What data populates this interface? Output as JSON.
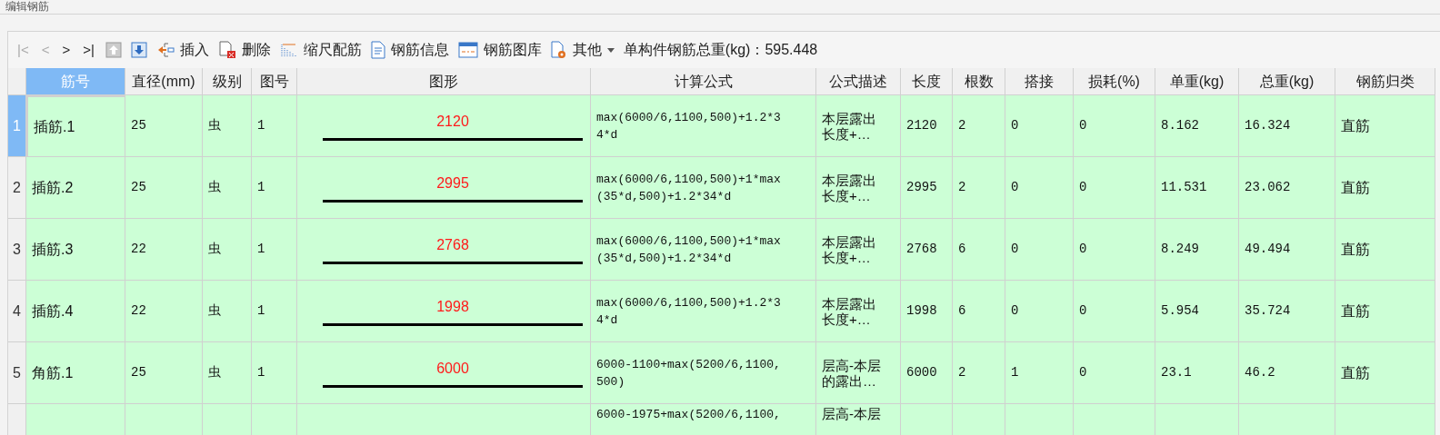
{
  "window": {
    "title": "编辑钢筋"
  },
  "toolbar": {
    "items": [
      {
        "kind": "nav",
        "label": "|<",
        "disabled": true
      },
      {
        "kind": "nav",
        "label": "<",
        "disabled": true
      },
      {
        "kind": "nav",
        "label": ">",
        "disabled": false
      },
      {
        "kind": "nav",
        "label": ">|",
        "disabled": false
      },
      {
        "kind": "up",
        "disabled": true
      },
      {
        "kind": "down",
        "disabled": false
      },
      {
        "kind": "insert",
        "label": "插入",
        "disabled": false
      },
      {
        "kind": "delete",
        "label": "删除",
        "disabled": false
      },
      {
        "kind": "scale",
        "label": "缩尺配筋",
        "disabled": false
      },
      {
        "kind": "info",
        "label": "钢筋信息",
        "disabled": false
      },
      {
        "kind": "library",
        "label": "钢筋图库",
        "disabled": false
      },
      {
        "kind": "other",
        "label": "其他",
        "disabled": false
      }
    ],
    "total": "单构件钢筋总重(kg)：595.448"
  },
  "table": {
    "columns": [
      {
        "label": "筋号",
        "selected": true
      },
      {
        "label": "直径(mm)",
        "selected": false
      },
      {
        "label": "级别",
        "selected": false
      },
      {
        "label": "图号",
        "selected": false
      },
      {
        "label": "图形",
        "selected": false
      },
      {
        "label": "计算公式",
        "selected": false
      },
      {
        "label": "公式描述",
        "selected": false
      },
      {
        "label": "长度",
        "selected": false
      },
      {
        "label": "根数",
        "selected": false
      },
      {
        "label": "搭接",
        "selected": false
      },
      {
        "label": "损耗(%)",
        "selected": false
      },
      {
        "label": "单重(kg)",
        "selected": false
      },
      {
        "label": "总重(kg)",
        "selected": false
      },
      {
        "label": "钢筋归类",
        "selected": false
      }
    ],
    "rows": [
      {
        "index": "1",
        "selected": true,
        "name": "插筋.1",
        "diameter": "25",
        "grade": "虫",
        "figure_no": "1",
        "shape_length": "2120",
        "formula": "max(6000/6,1100,500)+1.2*34*d",
        "description": "本层露出长度+…",
        "length": "2120",
        "count": "2",
        "lap": "0",
        "loss": "0",
        "unit_weight": "8.162",
        "total_weight": "16.324",
        "category": "直筋"
      },
      {
        "index": "2",
        "selected": false,
        "name": "插筋.2",
        "diameter": "25",
        "grade": "虫",
        "figure_no": "1",
        "shape_length": "2995",
        "formula": "max(6000/6,1100,500)+1*max(35*d,500)+1.2*34*d",
        "description": "本层露出长度+…",
        "length": "2995",
        "count": "2",
        "lap": "0",
        "loss": "0",
        "unit_weight": "11.531",
        "total_weight": "23.062",
        "category": "直筋"
      },
      {
        "index": "3",
        "selected": false,
        "name": "插筋.3",
        "diameter": "22",
        "grade": "虫",
        "figure_no": "1",
        "shape_length": "2768",
        "formula": "max(6000/6,1100,500)+1*max(35*d,500)+1.2*34*d",
        "description": "本层露出长度+…",
        "length": "2768",
        "count": "6",
        "lap": "0",
        "loss": "0",
        "unit_weight": "8.249",
        "total_weight": "49.494",
        "category": "直筋"
      },
      {
        "index": "4",
        "selected": false,
        "name": "插筋.4",
        "diameter": "22",
        "grade": "虫",
        "figure_no": "1",
        "shape_length": "1998",
        "formula": "max(6000/6,1100,500)+1.2*34*d",
        "description": "本层露出长度+…",
        "length": "1998",
        "count": "6",
        "lap": "0",
        "loss": "0",
        "unit_weight": "5.954",
        "total_weight": "35.724",
        "category": "直筋"
      },
      {
        "index": "5",
        "selected": false,
        "name": "角筋.1",
        "diameter": "25",
        "grade": "虫",
        "figure_no": "1",
        "shape_length": "6000",
        "formula": "6000-1100+max(5200/6,1100,500)",
        "description": "层高-本层的露出…",
        "length": "6000",
        "count": "2",
        "lap": "1",
        "loss": "0",
        "unit_weight": "23.1",
        "total_weight": "46.2",
        "category": "直筋"
      },
      {
        "selected": false,
        "formula": "6000-1975+max(5200/6,1100,",
        "description": "层高-本层"
      }
    ]
  }
}
